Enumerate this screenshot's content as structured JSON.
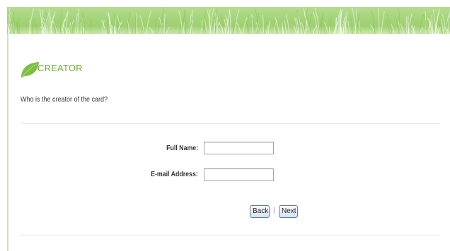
{
  "section": {
    "title": "CREATOR",
    "question": "Who is the creator of the card?"
  },
  "form": {
    "full_name": {
      "label": "Full Name:",
      "value": "",
      "placeholder": ""
    },
    "email": {
      "label": "E-mail Address:",
      "value": "",
      "placeholder": ""
    }
  },
  "actions": {
    "back_label": "Back",
    "separator": "|",
    "next_label": "Next"
  },
  "theme": {
    "accent_green": "#6dae2c",
    "banner_green": "#a6d57b",
    "button_border": "#5b7ea6"
  },
  "icons": {
    "section_icon": "leaf-icon"
  }
}
